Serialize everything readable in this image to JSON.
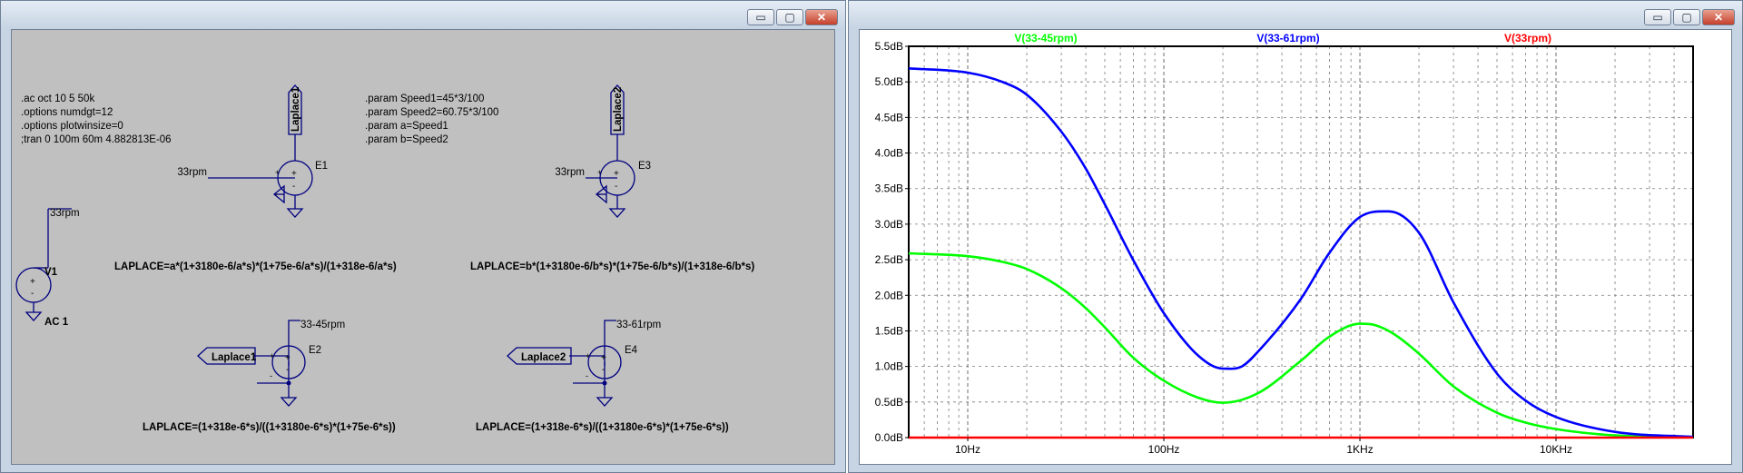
{
  "schematic": {
    "directives_left": [
      ".ac oct 10 5 50k",
      ".options numdgt=12",
      ".options plotwinsize=0",
      ";tran 0 100m 60m 4.882813E-06"
    ],
    "directives_right": [
      ".param Speed1=45*3/100",
      ".param Speed2=60.75*3/100",
      ".param a=Speed1",
      ".param b=Speed2"
    ],
    "labels": {
      "laplace1_port": "Laplace1",
      "laplace2_port": "Laplace2",
      "net_33rpm": "33rpm",
      "net_33_45rpm": "33-45rpm",
      "net_33_61rpm": "33-61rpm",
      "e1": "E1",
      "e2": "E2",
      "e3": "E3",
      "e4": "E4",
      "v1": "V1",
      "v1_value": "AC 1",
      "laplace_e1": "LAPLACE=a*(1+3180e-6/a*s)*(1+75e-6/a*s)/(1+318e-6/a*s)",
      "laplace_e3": "LAPLACE=b*(1+3180e-6/b*s)*(1+75e-6/b*s)/(1+318e-6/b*s)",
      "laplace_e2": "LAPLACE=(1+318e-6*s)/((1+3180e-6*s)*(1+75e-6*s))",
      "laplace_e4": "LAPLACE=(1+318e-6*s)/((1+3180e-6*s)*(1+75e-6*s))",
      "plus": "+",
      "minus": "-"
    }
  },
  "window_controls": {
    "minimize": "▭",
    "maximize": "▢",
    "close": "✕"
  },
  "chart_data": {
    "type": "line",
    "title": "",
    "xlabel": "",
    "ylabel": "",
    "x_scale": "log",
    "xlim": [
      5,
      50000
    ],
    "ylim": [
      0.0,
      5.5
    ],
    "x_ticks": [
      10,
      100,
      1000,
      10000
    ],
    "x_tick_labels": [
      "10Hz",
      "100Hz",
      "1KHz",
      "10KHz"
    ],
    "y_ticks": [
      0,
      0.5,
      1,
      1.5,
      2,
      2.5,
      3,
      3.5,
      4,
      4.5,
      5,
      5.5
    ],
    "y_tick_labels": [
      "0.0dB",
      "0.5dB",
      "1.0dB",
      "1.5dB",
      "2.0dB",
      "2.5dB",
      "3.0dB",
      "3.5dB",
      "4.0dB",
      "4.5dB",
      "5.0dB",
      "5.5dB"
    ],
    "grid": true,
    "legend_placement": "top",
    "series": [
      {
        "name": "V(33-45rpm)",
        "color": "#00ff00",
        "x": [
          5,
          10,
          15,
          20,
          30,
          40,
          50,
          70,
          100,
          150,
          200,
          300,
          500,
          700,
          1000,
          1200,
          1500,
          2000,
          3000,
          5000,
          7000,
          10000,
          20000,
          50000
        ],
        "y": [
          2.59,
          2.55,
          2.47,
          2.37,
          2.1,
          1.82,
          1.55,
          1.12,
          0.8,
          0.56,
          0.49,
          0.62,
          1.08,
          1.42,
          1.6,
          1.58,
          1.45,
          1.18,
          0.72,
          0.35,
          0.21,
          0.12,
          0.03,
          0.005
        ]
      },
      {
        "name": "V(33-61rpm)",
        "color": "#0000ff",
        "x": [
          5,
          10,
          15,
          20,
          30,
          40,
          50,
          70,
          100,
          150,
          200,
          250,
          300,
          500,
          700,
          1000,
          1400,
          2000,
          3000,
          5000,
          7000,
          10000,
          20000,
          50000
        ],
        "y": [
          5.19,
          5.13,
          5.0,
          4.82,
          4.3,
          3.78,
          3.28,
          2.49,
          1.75,
          1.15,
          0.97,
          1.0,
          1.2,
          1.95,
          2.6,
          3.1,
          3.18,
          2.88,
          1.9,
          0.9,
          0.52,
          0.29,
          0.08,
          0.01
        ]
      },
      {
        "name": "V(33rpm)",
        "color": "#ff0000",
        "x": [
          5,
          50000
        ],
        "y": [
          0.0,
          0.0
        ]
      }
    ]
  }
}
